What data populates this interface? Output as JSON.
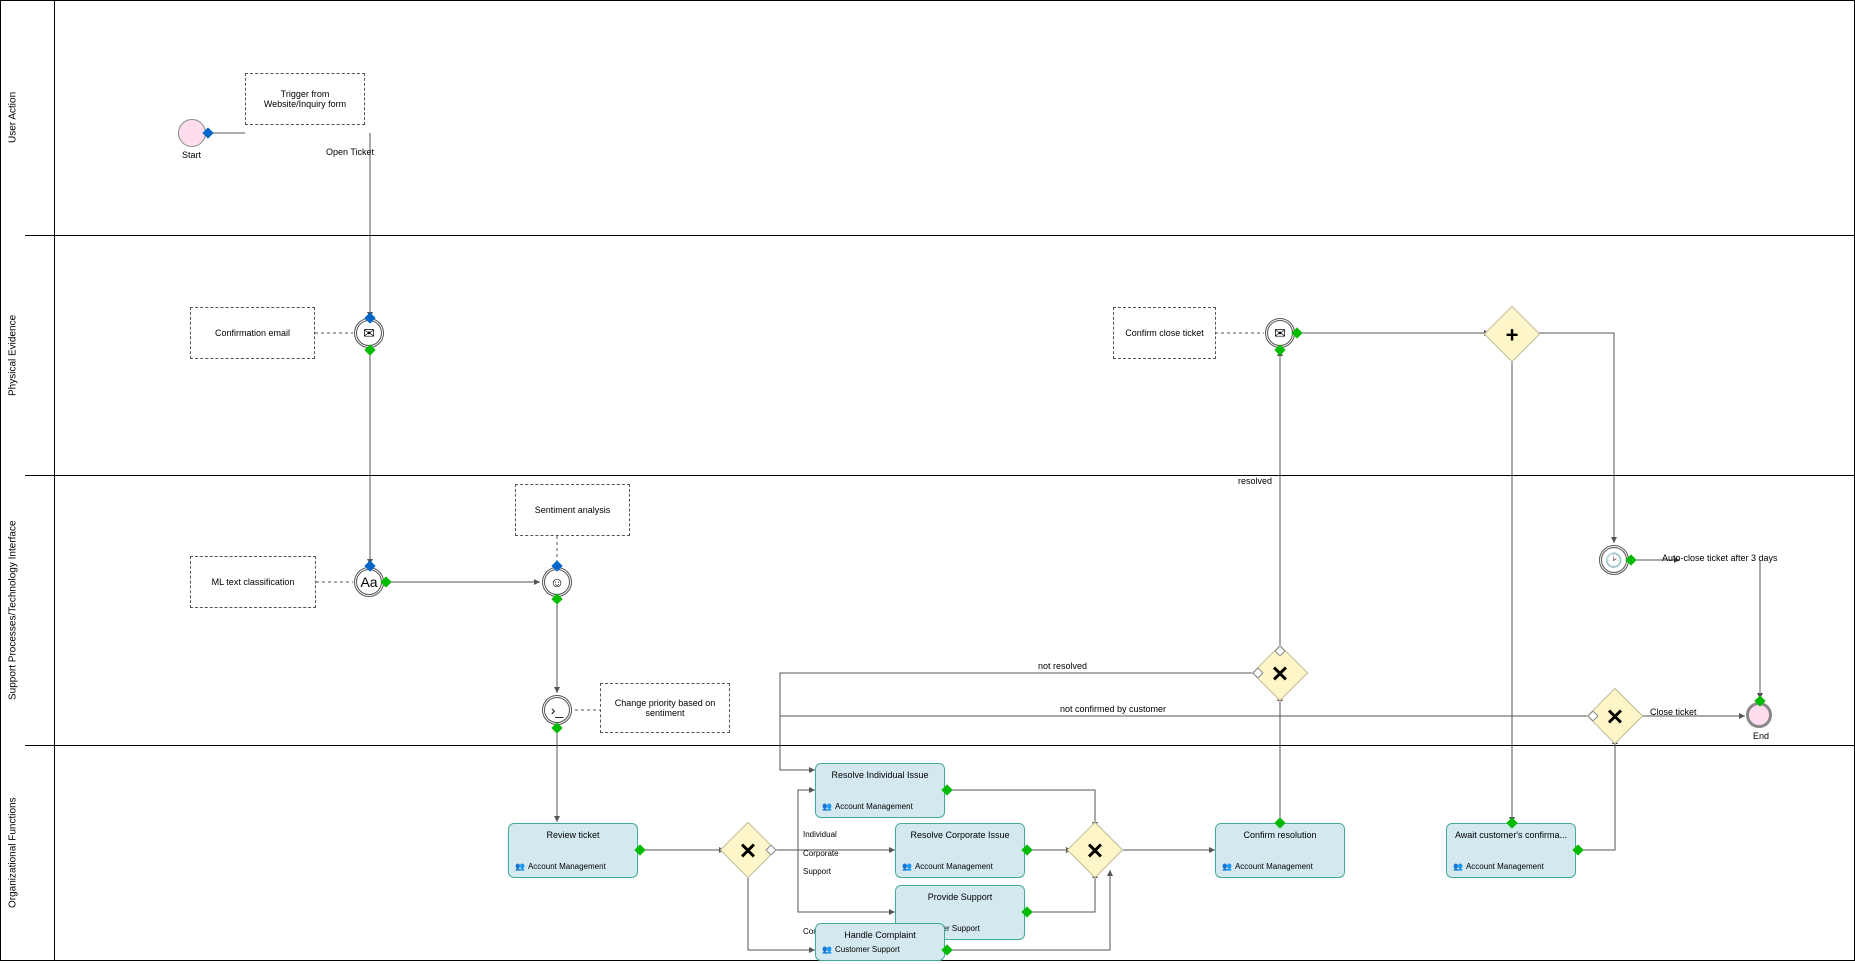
{
  "lanes": {
    "user_action": "User Action",
    "physical_evidence": "Physical Evidence",
    "support_tech": "Support Processes/Technology Interface",
    "org_functions": "Organizational Functions"
  },
  "events": {
    "start": "Start",
    "end": "End",
    "timer_label": "Auto-close ticket after 3 days"
  },
  "annotations": {
    "trigger": "Trigger from Website/Inquiry form",
    "confirmation": "Confirmation email",
    "ml": "ML text classification",
    "sentiment": "Sentiment analysis",
    "change_priority": "Change priority based on sentiment",
    "confirm_close": "Confirm close ticket"
  },
  "tasks": {
    "review": {
      "title": "Review ticket",
      "role": "Account Management"
    },
    "resolve_individual": {
      "title": "Resolve Individual Issue",
      "role": "Account Management"
    },
    "resolve_corporate": {
      "title": "Resolve Corporate Issue",
      "role": "Account Management"
    },
    "provide_support": {
      "title": "Provide Support",
      "role": "Customer Support"
    },
    "handle_complaint": {
      "title": "Handle Complaint",
      "role": "Customer Support"
    },
    "confirm_resolution": {
      "title": "Confirm resolution",
      "role": "Account Management"
    },
    "await_confirm": {
      "title": "Await customer's confirma...",
      "role": "Account Management"
    }
  },
  "edges": {
    "open_ticket": "Open Ticket",
    "individual": "Individual",
    "corporate": "Corporate",
    "support": "Support",
    "complaint": "Complaint",
    "resolved": "resolved",
    "not_resolved": "not resolved",
    "not_confirmed": "not confirmed by customer",
    "close_ticket": "Close ticket"
  },
  "icons": {
    "envelope": "✉",
    "clock": "◔",
    "plus": "+",
    "x": "✕"
  }
}
